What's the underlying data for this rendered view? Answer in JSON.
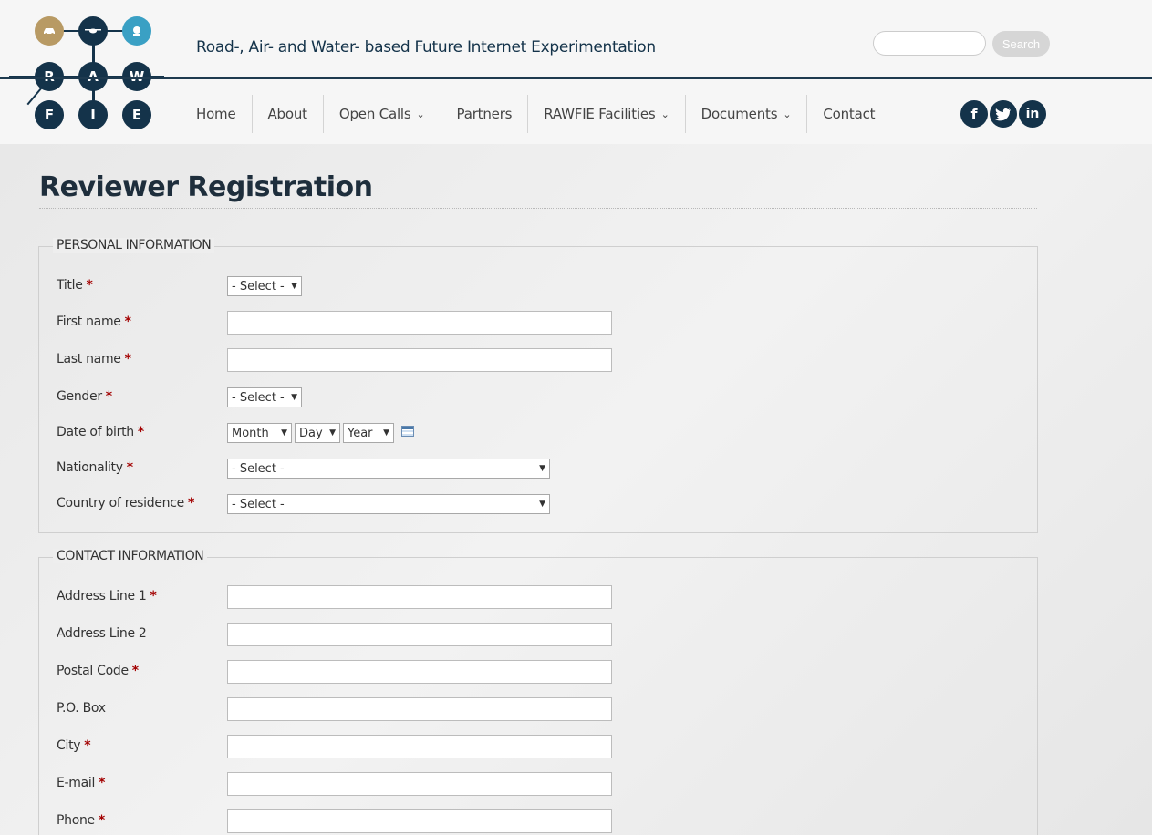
{
  "header": {
    "logo_letters": [
      "R",
      "A",
      "W",
      "F",
      "I",
      "E"
    ],
    "tagline": "Road-, Air- and Water- based Future Internet Experimentation",
    "search_placeholder": "",
    "search_button": "Search",
    "nav": [
      {
        "label": "Home",
        "has_dropdown": false
      },
      {
        "label": "About",
        "has_dropdown": false
      },
      {
        "label": "Open Calls",
        "has_dropdown": true
      },
      {
        "label": "Partners",
        "has_dropdown": false
      },
      {
        "label": "RAWFIE Facilities",
        "has_dropdown": true
      },
      {
        "label": "Documents",
        "has_dropdown": true
      },
      {
        "label": "Contact",
        "has_dropdown": false
      }
    ],
    "social": [
      "f",
      "t",
      "in"
    ],
    "social_icons": [
      "facebook-icon",
      "twitter-icon",
      "linkedin-icon"
    ]
  },
  "page": {
    "title": "Reviewer Registration"
  },
  "personal": {
    "legend": "PERSONAL INFORMATION",
    "title_label": "Title",
    "title_value": "- Select -",
    "first_name_label": "First name",
    "last_name_label": "Last name",
    "gender_label": "Gender",
    "gender_value": "- Select -",
    "dob_label": "Date of birth",
    "dob_month": "Month",
    "dob_day": "Day",
    "dob_year": "Year",
    "nationality_label": "Nationality",
    "nationality_value": "- Select -",
    "residence_label": "Country of residence",
    "residence_value": "- Select -"
  },
  "contact": {
    "legend": "CONTACT INFORMATION",
    "address1_label": "Address Line 1",
    "address2_label": "Address Line 2",
    "postal_label": "Postal Code",
    "pobox_label": "P.O. Box",
    "city_label": "City",
    "email_label": "E-mail",
    "phone_label": "Phone"
  },
  "required_marker": "*",
  "colors": {
    "brand_navy": "#14334a",
    "logo_gold": "#b89a64",
    "logo_teal": "#3aa0c4",
    "required_red": "#a30000"
  }
}
